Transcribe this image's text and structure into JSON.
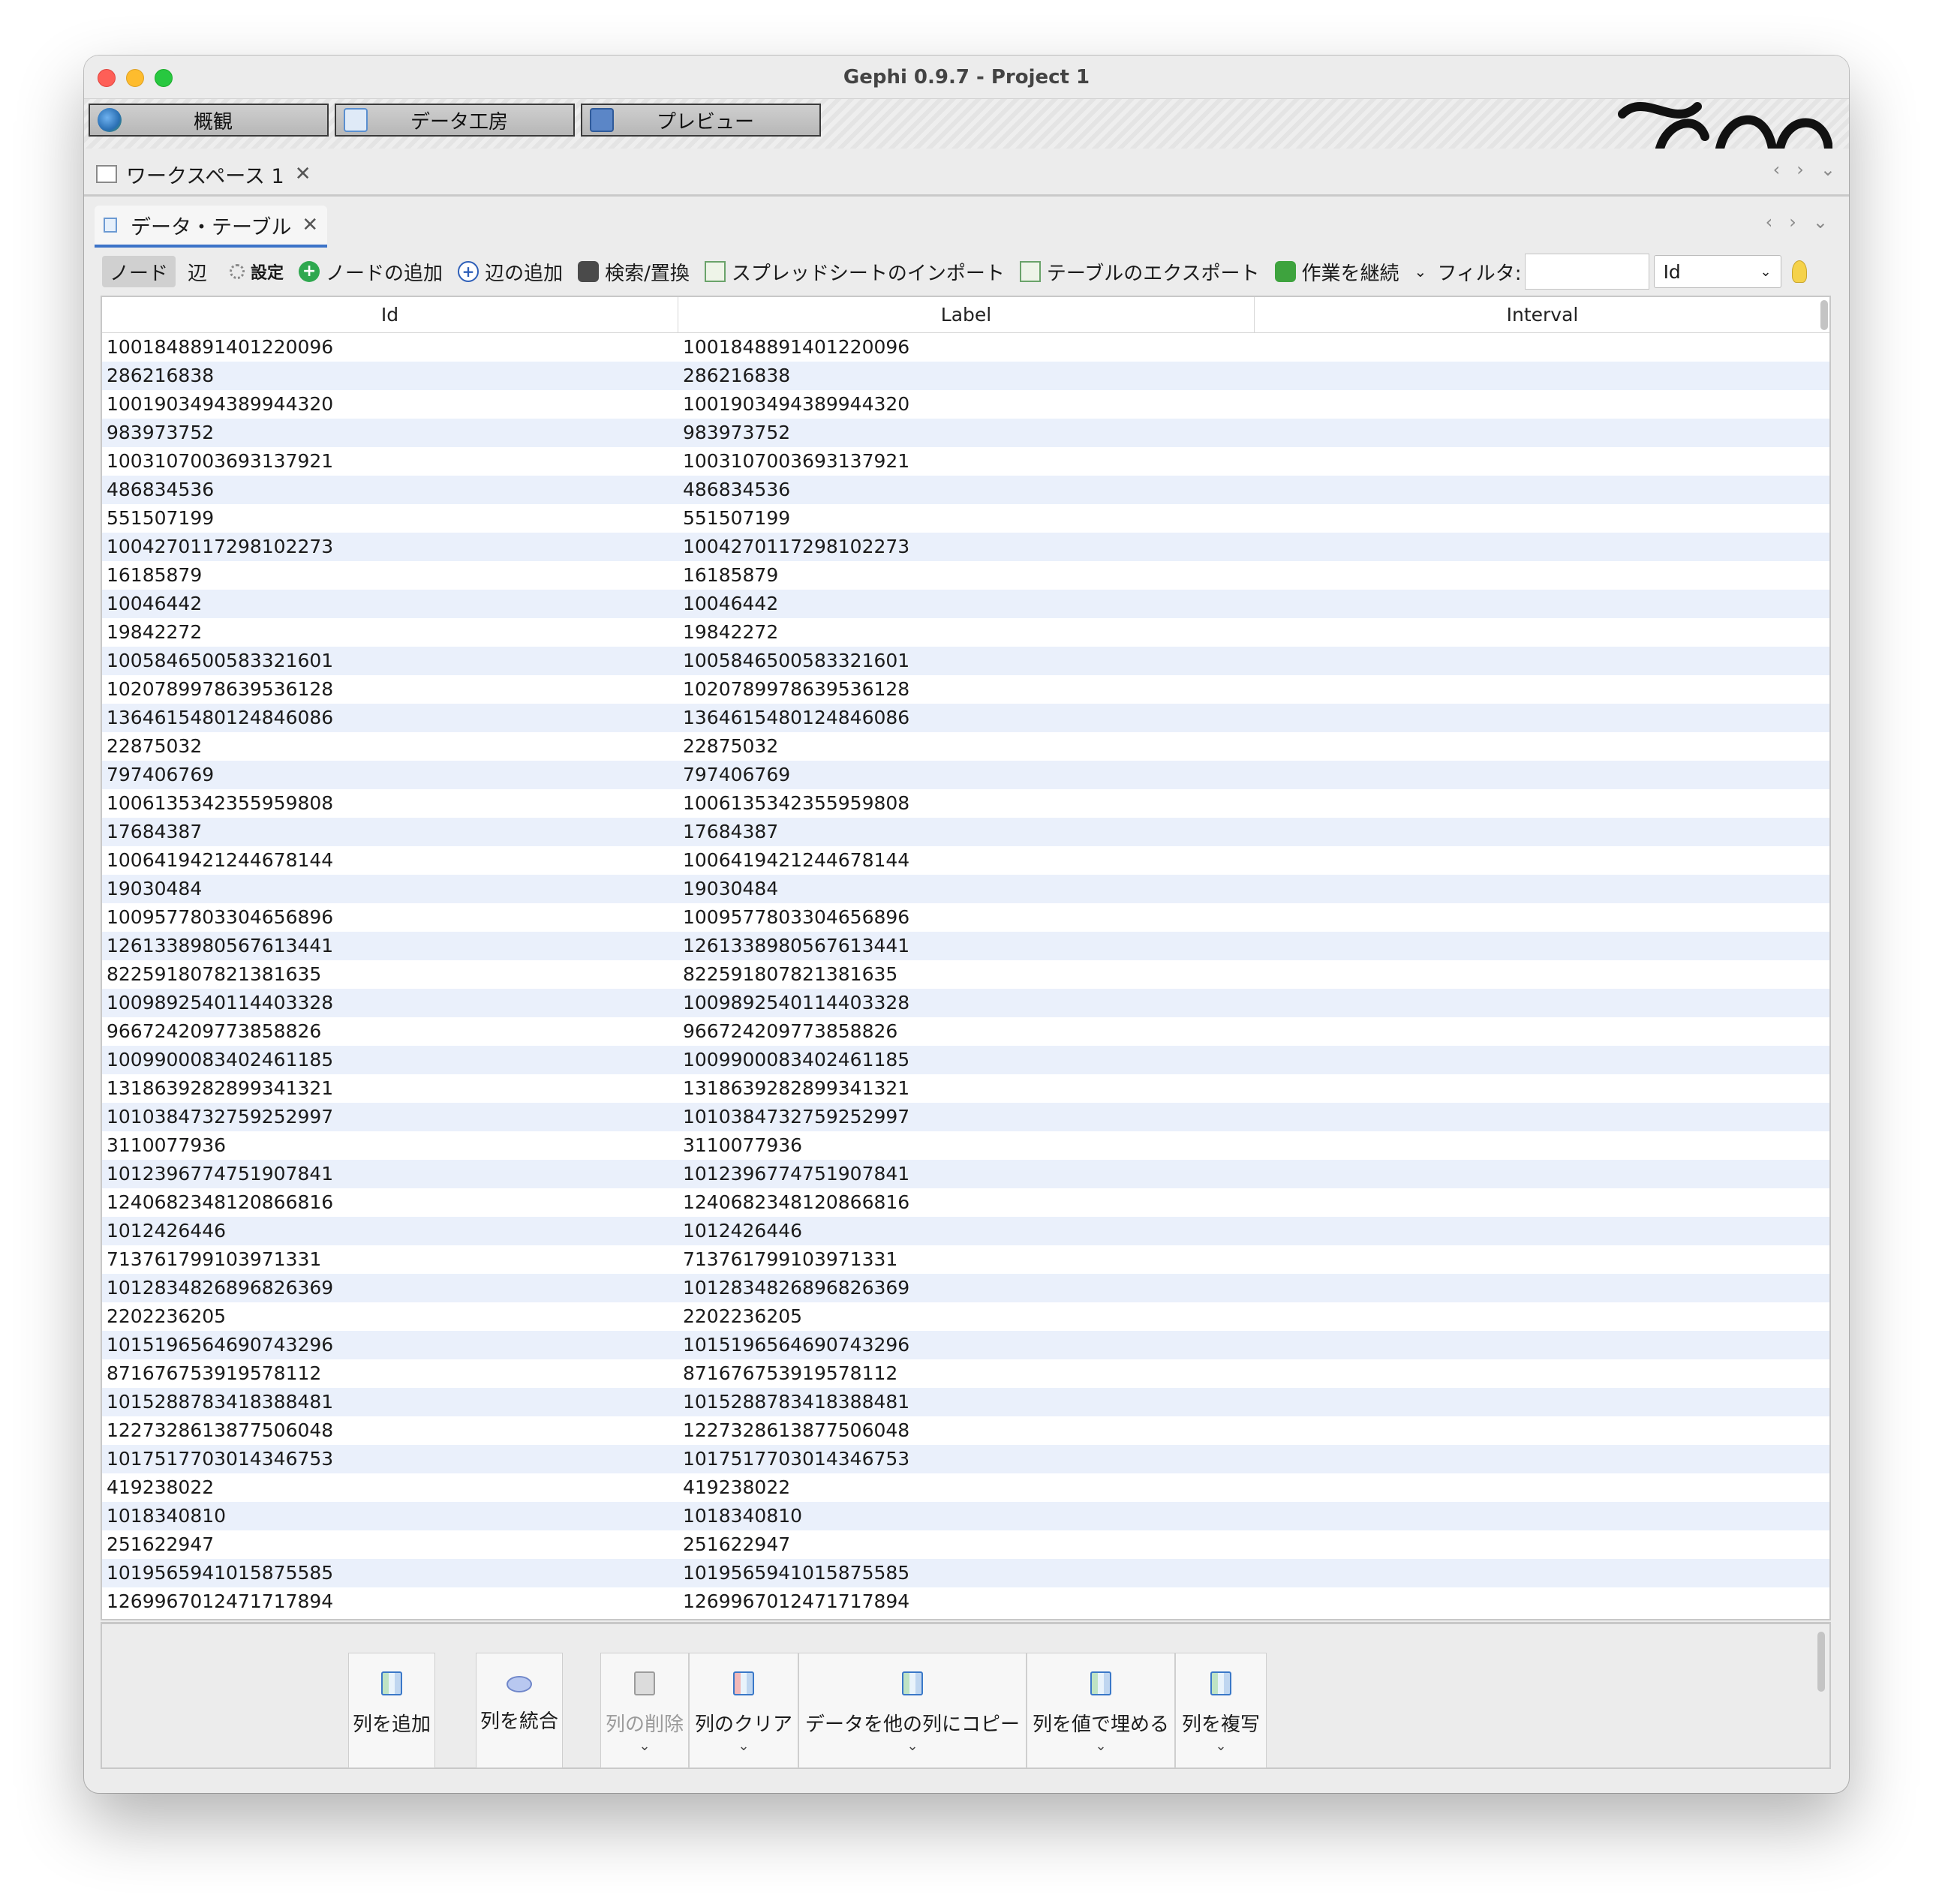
{
  "window": {
    "title": "Gephi 0.9.7 - Project 1"
  },
  "perspectives": [
    {
      "label": "概観",
      "icon": "globe-icon"
    },
    {
      "label": "データ工房",
      "icon": "table-icon"
    },
    {
      "label": "プレビュー",
      "icon": "monitor-icon"
    }
  ],
  "workspace_tab": {
    "label": "ワークスペース 1",
    "close": "✕"
  },
  "data_table_tab": {
    "label": "データ・テーブル",
    "close": "✕"
  },
  "nav": {
    "prev": "‹",
    "next": "›",
    "menu": "⌄"
  },
  "toolbar": {
    "nodes": "ノード",
    "edges": "辺",
    "settings": "設定",
    "add_node": "ノードの追加",
    "add_edge": "辺の追加",
    "search_replace": "検索/置換",
    "import_spreadsheet": "スプレッドシートのインポート",
    "export_table": "テーブルのエクスポート",
    "more_actions": "作業を継続",
    "filter_label": "フィルタ:",
    "filter_value": "",
    "filter_column": "Id"
  },
  "table": {
    "columns": [
      "Id",
      "Label",
      "Interval"
    ],
    "rows": [
      [
        "1001848891401220096",
        "1001848891401220096",
        ""
      ],
      [
        "286216838",
        "286216838",
        ""
      ],
      [
        "1001903494389944320",
        "1001903494389944320",
        ""
      ],
      [
        "983973752",
        "983973752",
        ""
      ],
      [
        "1003107003693137921",
        "1003107003693137921",
        ""
      ],
      [
        "486834536",
        "486834536",
        ""
      ],
      [
        "551507199",
        "551507199",
        ""
      ],
      [
        "1004270117298102273",
        "1004270117298102273",
        ""
      ],
      [
        "16185879",
        "16185879",
        ""
      ],
      [
        "10046442",
        "10046442",
        ""
      ],
      [
        "19842272",
        "19842272",
        ""
      ],
      [
        "1005846500583321601",
        "1005846500583321601",
        ""
      ],
      [
        "1020789978639536128",
        "1020789978639536128",
        ""
      ],
      [
        "1364615480124846086",
        "1364615480124846086",
        ""
      ],
      [
        "22875032",
        "22875032",
        ""
      ],
      [
        "797406769",
        "797406769",
        ""
      ],
      [
        "1006135342355959808",
        "1006135342355959808",
        ""
      ],
      [
        "17684387",
        "17684387",
        ""
      ],
      [
        "1006419421244678144",
        "1006419421244678144",
        ""
      ],
      [
        "19030484",
        "19030484",
        ""
      ],
      [
        "1009577803304656896",
        "1009577803304656896",
        ""
      ],
      [
        "1261338980567613441",
        "1261338980567613441",
        ""
      ],
      [
        "822591807821381635",
        "822591807821381635",
        ""
      ],
      [
        "1009892540114403328",
        "1009892540114403328",
        ""
      ],
      [
        "966724209773858826",
        "966724209773858826",
        ""
      ],
      [
        "1009900083402461185",
        "1009900083402461185",
        ""
      ],
      [
        "1318639282899341321",
        "1318639282899341321",
        ""
      ],
      [
        "1010384732759252997",
        "1010384732759252997",
        ""
      ],
      [
        "3110077936",
        "3110077936",
        ""
      ],
      [
        "1012396774751907841",
        "1012396774751907841",
        ""
      ],
      [
        "1240682348120866816",
        "1240682348120866816",
        ""
      ],
      [
        "1012426446",
        "1012426446",
        ""
      ],
      [
        "713761799103971331",
        "713761799103971331",
        ""
      ],
      [
        "1012834826896826369",
        "1012834826896826369",
        ""
      ],
      [
        "2202236205",
        "2202236205",
        ""
      ],
      [
        "1015196564690743296",
        "1015196564690743296",
        ""
      ],
      [
        "871676753919578112",
        "871676753919578112",
        ""
      ],
      [
        "1015288783418388481",
        "1015288783418388481",
        ""
      ],
      [
        "1227328613877506048",
        "1227328613877506048",
        ""
      ],
      [
        "1017517703014346753",
        "1017517703014346753",
        ""
      ],
      [
        "419238022",
        "419238022",
        ""
      ],
      [
        "1018340810",
        "1018340810",
        ""
      ],
      [
        "251622947",
        "251622947",
        ""
      ],
      [
        "1019565941015875585",
        "1019565941015875585",
        ""
      ],
      [
        "1269967012471717894",
        "1269967012471717894",
        ""
      ]
    ]
  },
  "column_actions": [
    {
      "label": "列を追加",
      "icon": "add-column-icon",
      "enabled": true,
      "dropdown": false
    },
    {
      "label": "列を統合",
      "icon": "merge-columns-icon",
      "enabled": true,
      "dropdown": false
    },
    {
      "label": "列の削除",
      "icon": "delete-column-icon",
      "enabled": false,
      "dropdown": true
    },
    {
      "label": "列のクリア",
      "icon": "clear-column-icon",
      "enabled": true,
      "dropdown": true
    },
    {
      "label": "データを他の列にコピー",
      "icon": "copy-data-icon",
      "enabled": true,
      "dropdown": true
    },
    {
      "label": "列を値で埋める",
      "icon": "fill-column-icon",
      "enabled": true,
      "dropdown": true
    },
    {
      "label": "列を複写",
      "icon": "duplicate-column-icon",
      "enabled": true,
      "dropdown": true
    }
  ],
  "colors": {
    "selected_tab_underline": "#3c73c8",
    "row_stripe": "#eaf0fb"
  }
}
